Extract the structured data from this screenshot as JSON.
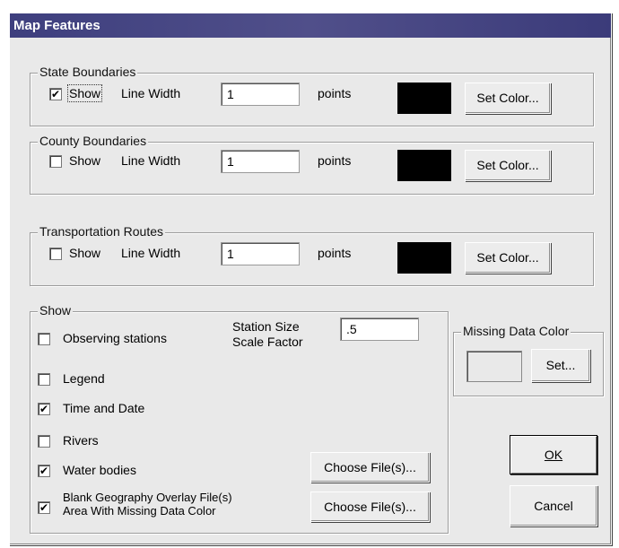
{
  "window": {
    "title": "Map Features"
  },
  "state": {
    "title": "State Boundaries",
    "show_label": "Show",
    "show_checked": true,
    "line_width_label": "Line Width",
    "line_width_value": "1",
    "units": "points",
    "color": "#000000",
    "set_color_label": "Set Color..."
  },
  "county": {
    "title": "County Boundaries",
    "show_label": "Show",
    "show_checked": false,
    "line_width_label": "Line Width",
    "line_width_value": "1",
    "units": "points",
    "color": "#000000",
    "set_color_label": "Set Color..."
  },
  "transport": {
    "title": "Transportation Routes",
    "show_label": "Show",
    "show_checked": false,
    "line_width_label": "Line Width",
    "line_width_value": "1",
    "units": "points",
    "color": "#000000",
    "set_color_label": "Set Color..."
  },
  "show": {
    "title": "Show",
    "observing": {
      "label": "Observing stations",
      "checked": false
    },
    "station_size_label_1": "Station Size",
    "station_size_label_2": "Scale Factor",
    "station_size_value": ".5",
    "legend": {
      "label": "Legend",
      "checked": false
    },
    "time_date": {
      "label": "Time and Date",
      "checked": true
    },
    "rivers": {
      "label": "Rivers",
      "checked": false
    },
    "water": {
      "label": "Water bodies",
      "checked": true
    },
    "blank_geo": {
      "label_1": "Blank Geography Overlay File(s)",
      "label_2": "Area With Missing Data Color",
      "checked": true
    },
    "choose_files_1": "Choose File(s)...",
    "choose_files_2": "Choose File(s)..."
  },
  "missing": {
    "title": "Missing Data Color",
    "set_label": "Set..."
  },
  "buttons": {
    "ok": "OK",
    "cancel": "Cancel"
  },
  "checkmark": "✔"
}
